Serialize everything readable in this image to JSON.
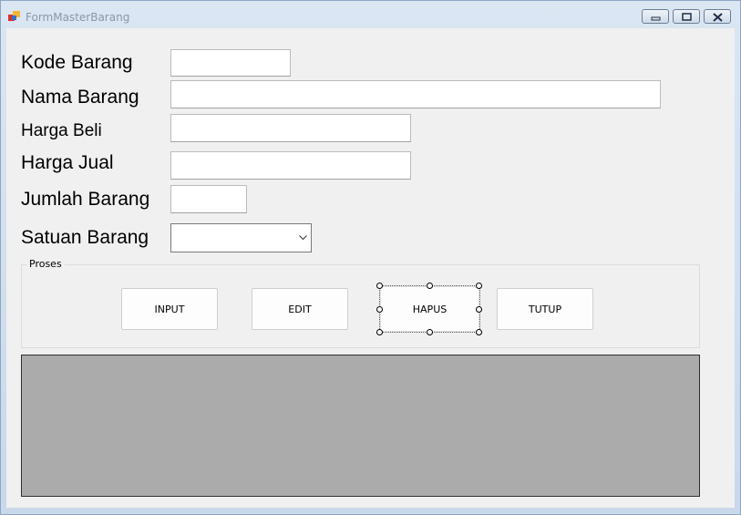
{
  "window": {
    "title": "FormMasterBarang"
  },
  "fields": {
    "kode_barang": {
      "label": "Kode Barang",
      "value": ""
    },
    "nama_barang": {
      "label": "Nama Barang",
      "value": ""
    },
    "harga_beli": {
      "label": "Harga Beli",
      "value": ""
    },
    "harga_jual": {
      "label": "Harga Jual",
      "value": ""
    },
    "jumlah_barang": {
      "label": "Jumlah Barang",
      "value": ""
    },
    "satuan_barang": {
      "label": "Satuan Barang",
      "value": ""
    }
  },
  "group": {
    "caption": "Proses",
    "buttons": {
      "input": "INPUT",
      "edit": "EDIT",
      "hapus": "HAPUS",
      "tutup": "TUTUP"
    }
  },
  "colors": {
    "form_bg": "#f0f0f0",
    "grid_bg": "#ababab",
    "title_text": "#8a97a6"
  },
  "icons": {
    "app": "form-app-icon",
    "minimize": "minimize-icon",
    "maximize": "maximize-icon",
    "close": "close-icon",
    "dropdown": "chevron-down-icon"
  }
}
